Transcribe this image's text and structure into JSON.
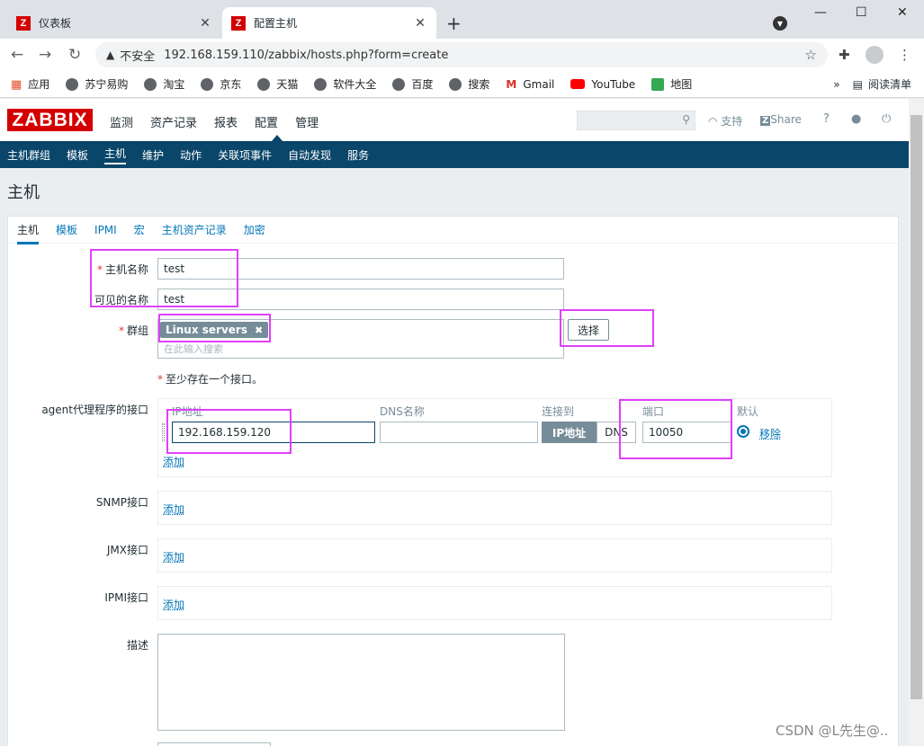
{
  "browser": {
    "tabs": [
      {
        "title": "仪表板",
        "active": false
      },
      {
        "title": "配置主机",
        "active": true
      }
    ],
    "insecure_label": "不安全",
    "url": "192.168.159.110/zabbix/hosts.php?form=create",
    "bookmarks": [
      "应用",
      "苏宁易购",
      "淘宝",
      "京东",
      "天猫",
      "软件大全",
      "百度",
      "搜索",
      "Gmail",
      "YouTube",
      "地图"
    ],
    "reading_list": "阅读清单",
    "overflow": "»"
  },
  "zabbix": {
    "logo": "ZABBIX",
    "top_menu": [
      "监测",
      "资产记录",
      "报表",
      "配置",
      "管理"
    ],
    "support": "支持",
    "share": "Share",
    "help": "?",
    "sub_menu": [
      "主机群组",
      "模板",
      "主机",
      "维护",
      "动作",
      "关联项事件",
      "自动发现",
      "服务"
    ],
    "page_title": "主机",
    "form_tabs": [
      "主机",
      "模板",
      "IPMI",
      "宏",
      "主机资产记录",
      "加密"
    ],
    "form": {
      "host_name_label": "主机名称",
      "host_name_value": "test",
      "visible_name_label": "可见的名称",
      "visible_name_value": "test",
      "groups_label": "群组",
      "group_chip": "Linux servers",
      "group_placeholder": "在此输入搜索",
      "select_button": "选择",
      "interface_note": "至少存在一个接口。",
      "agent_label": "agent代理程序的接口",
      "col_ip": "IP地址",
      "col_dns": "DNS名称",
      "col_connect": "连接到",
      "col_port": "端口",
      "col_default": "默认",
      "ip_value": "192.168.159.120",
      "dns_value": "",
      "connect_ip": "IP地址",
      "connect_dns": "DNS",
      "port_value": "10050",
      "remove": "移除",
      "add": "添加",
      "snmp_label": "SNMP接口",
      "jmx_label": "JMX接口",
      "ipmi_label": "IPMI接口",
      "description_label": "描述"
    }
  },
  "watermark": "CSDN @L先生@..",
  "colors": {
    "brand": "#d40000",
    "subnav": "#0a466a",
    "link": "#0275b8",
    "highlight": "#e040fb"
  }
}
